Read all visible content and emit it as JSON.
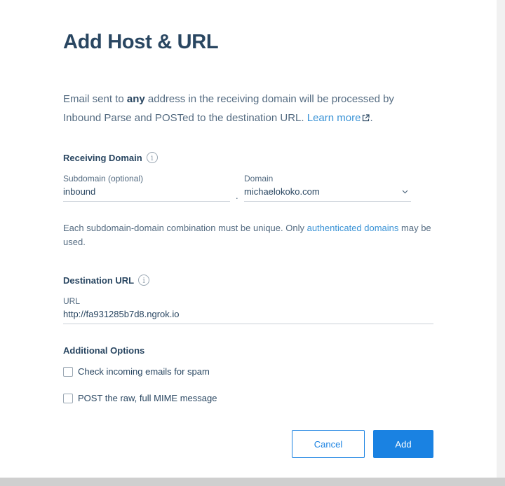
{
  "modal": {
    "title": "Add Host & URL",
    "intro": {
      "part1": "Email sent to ",
      "bold": "any",
      "part2": " address in the receiving domain will be processed by Inbound Parse and POSTed to the destination URL. ",
      "link": "Learn more",
      "end": "."
    },
    "receiving_domain": {
      "label": "Receiving Domain",
      "subdomain_label": "Subdomain (optional)",
      "subdomain_value": "inbound",
      "separator": ".",
      "domain_label": "Domain",
      "domain_value": "michaelokoko.com",
      "helper_text": "Each subdomain-domain combination must be unique. Only ",
      "helper_link": "authenticated domains",
      "helper_end": " may be used."
    },
    "destination": {
      "label": "Destination URL",
      "url_label": "URL",
      "url_value": "http://fa931285b7d8.ngrok.io"
    },
    "options": {
      "label": "Additional Options",
      "spam_check": "Check incoming emails for spam",
      "raw_post": "POST the raw, full MIME message"
    },
    "buttons": {
      "cancel": "Cancel",
      "add": "Add"
    }
  },
  "colors": {
    "brand_blue": "#1a82e2",
    "heading": "#294661",
    "body_text": "#546b81"
  },
  "icons": {
    "info": "info-icon",
    "external": "external-link-icon",
    "chevron": "chevron-down-icon"
  }
}
